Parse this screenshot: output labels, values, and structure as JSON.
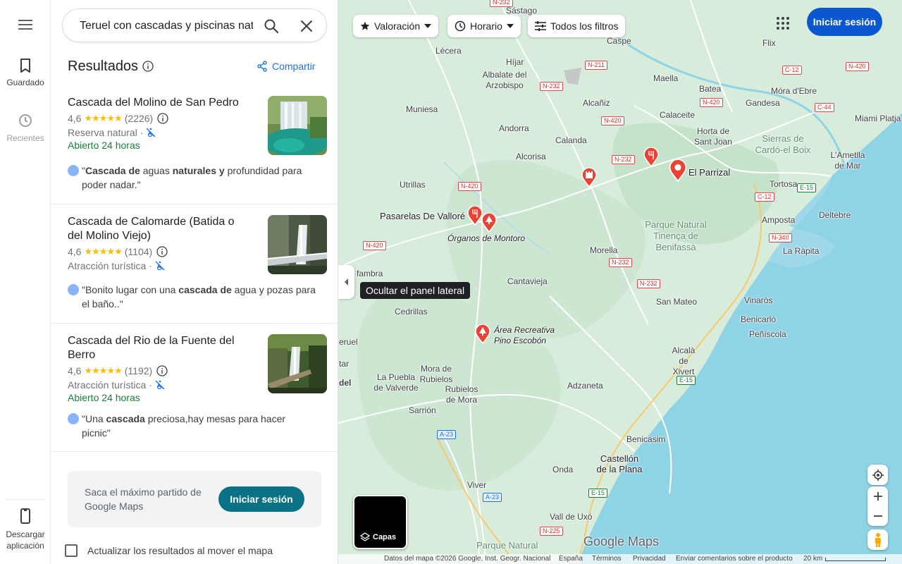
{
  "rail": {
    "saved_label": "Guardado",
    "recents_label": "Recientes",
    "download_label": "Descargar aplicación"
  },
  "search": {
    "value": "Teruel con cascadas y piscinas naturales"
  },
  "results": {
    "title": "Resultados",
    "share_label": "Compartir"
  },
  "cards": [
    {
      "title": "Cascada del Molino de San Pedro",
      "rating": "4,6",
      "stars": "★★★★★",
      "reviews": "(2226)",
      "type": "Reserva natural ·",
      "hours": "Abierto 24 horas",
      "review_pre": "\"",
      "review_b1": "Cascada de",
      "review_mid1": " aguas ",
      "review_b2": "naturales y",
      "review_post": " profundidad para poder nadar.\""
    },
    {
      "title": "Cascada de Calomarde (Batida o del Molino Viejo)",
      "rating": "4,6",
      "stars": "★★★★★",
      "reviews": "(1104)",
      "type": "Atracción turística ·",
      "review_pre": "\"Bonito lugar con una ",
      "review_b1": "cascada de",
      "review_post": " agua y pozas para el baño..\""
    },
    {
      "title": "Cascada del Rio de la Fuente del Berro",
      "rating": "4,6",
      "stars": "★★★★★",
      "reviews": "(1192)",
      "type": "Atracción turística ·",
      "hours": "Abierto 24 horas",
      "review_pre": "\"Una ",
      "review_b1": "cascada",
      "review_post": " preciosa,hay mesas para hacer picnic\""
    }
  ],
  "promo": {
    "text": "Saca el máximo partido de Google Maps",
    "button": "Iniciar sesión"
  },
  "update_label": "Actualizar los resultados al mover el mapa",
  "chips": {
    "rating": "Valoración",
    "hours": "Horario",
    "filters": "Todos los filtros"
  },
  "signin_label": "Iniciar sesión",
  "tooltip": "Ocultar el panel lateral",
  "layers_label": "Capas",
  "logo_text": "Google Maps",
  "footer": {
    "data": "Datos del mapa ©2026 Google, Inst. Geogr. Nacional",
    "country": "España",
    "terms": "Términos",
    "privacy": "Privacidad",
    "feedback": "Enviar comentarios sobre el producto",
    "scale": "20 km"
  },
  "map_labels": {
    "sastago": "Sástago",
    "caspe": "Caspe",
    "flix": "Flix",
    "lecera": "Lécera",
    "hijar": "Híjar",
    "albalate": "Albalate del Arzobispo",
    "maella": "Maella",
    "batea": "Batea",
    "mora": "Móra d'Ebre",
    "muniesa": "Muniesa",
    "alcaniz": "Alcañiz",
    "calaceite": "Calaceite",
    "gandesa": "Gandesa",
    "miami": "Miami Platja",
    "andorra": "Andorra",
    "horta": "Horta de Sant Joan",
    "sierras": "Sierras de Cardó-el Boix",
    "calanda": "Calanda",
    "alcorisa": "Alcorisa",
    "parrizal": "El Parrizal",
    "ametlla": "L'Ametlla de Mar",
    "utrillas": "Utrillas",
    "tortosa": "Tortosa",
    "pasarelas": "Pasarelas De Valloré",
    "organos": "Órganos de Montoro",
    "tinenca": "Parque Natural Tinença de Benifassà",
    "amposta": "Amposta",
    "deltebre": "Deltebre",
    "morella": "Morella",
    "rapita": "La Ràpita",
    "fambra": "fambra",
    "cantavieja": "Cantavieja",
    "sanmateo": "San Mateo",
    "vinaros": "Vinaròs",
    "cedrillas": "Cedrillas",
    "benicarlo": "Benicarló",
    "peniscola": "Peñíscola",
    "area": "Área Recreativa Pino Escobón",
    "erue": "eruel",
    "tar": "tar",
    "del": "del",
    "alcala": "Alcalà de Xivert",
    "mora_rub": "Mora de Rubielos",
    "puebla": "La Puebla de Valverde",
    "rubielos": "Rubielos de Mora",
    "adzaneta": "Adzaneta",
    "sarrion": "Sarrión",
    "benicasim": "Benicasim",
    "castellon": "Castellón de la Plana",
    "onda": "Onda",
    "viver": "Viver",
    "valluxo": "Vall de Uxó",
    "parque_natural": "Parque Natural"
  },
  "roads": {
    "n232": "N-232",
    "n211": "N-211",
    "n420": "N-420",
    "c12": "C-12",
    "c44": "C-44",
    "e15": "E-15",
    "n340": "N-340",
    "a23": "A-23",
    "n225": "N-225"
  }
}
